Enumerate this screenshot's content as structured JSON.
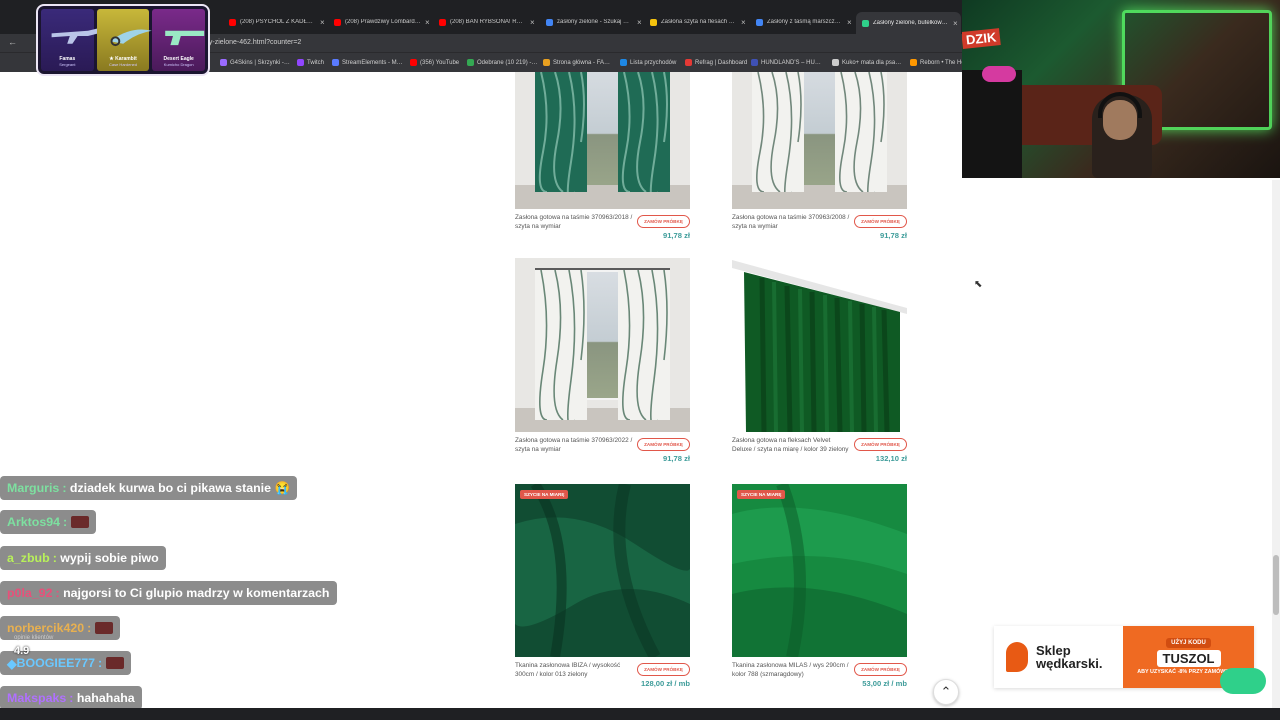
{
  "browser": {
    "tabs": [
      {
        "title": "(208) PSYCHOL Z KADŁUB…",
        "fav": "#ff0000"
      },
      {
        "title": "(208) Prawdziwy Lombard…",
        "fav": "#ff0000"
      },
      {
        "title": "(208) BAN RYBSONA! RO…",
        "fav": "#ff0000"
      },
      {
        "title": "zasłony zielone - Szukaj w…",
        "fav": "#4285f4"
      },
      {
        "title": "Zasłona szyta na flesach z…",
        "fav": "#f4c20d"
      },
      {
        "title": "Zasłony z taśmą marszczą…",
        "fav": "#4285f4"
      },
      {
        "title": "Zasłony zielone, butelkow…",
        "fav": "#2fd08a"
      }
    ],
    "url": "ny-zielone-462.html?counter=2",
    "bookmarks": [
      {
        "label": "G4Skins | Skrzynki -…",
        "color": "#9a6bff"
      },
      {
        "label": "Twitch",
        "color": "#9146ff"
      },
      {
        "label": "StreamElements - M…",
        "color": "#5a7bff"
      },
      {
        "label": "(356) YouTube",
        "color": "#ff0000"
      },
      {
        "label": "Odebrane (10 219) -…",
        "color": "#34a853"
      },
      {
        "label": "Strona główna - FA…",
        "color": "#e8a020"
      },
      {
        "label": "Lista przychodów",
        "color": "#1e88e5"
      },
      {
        "label": "Refrag | Dashboard",
        "color": "#e53935"
      },
      {
        "label": "HUNDLAND'S – HU…",
        "color": "#3f51b5"
      },
      {
        "label": "Kuko+ mata dla psa…",
        "color": "#cccccc"
      },
      {
        "label": "Reborn • The Ho…",
        "color": "#ff9800"
      }
    ]
  },
  "skins": [
    {
      "name": "Famas",
      "sub": "Sergeant"
    },
    {
      "name": "★ Karambit",
      "sub": "Case Hardened"
    },
    {
      "name": "Desert Eagle",
      "sub": "Kumicho Dragon"
    }
  ],
  "webcam": {
    "logo": "DZIK"
  },
  "products": [
    {
      "name": "Zasłona gotowa na taśmie 370963/2018 / szyta na wymiar",
      "button": "ZAMÓW PRÓBKĘ",
      "price": "91,78 zł"
    },
    {
      "name": "Zasłona gotowa na taśmie 370963/2008 / szyta na wymiar",
      "button": "ZAMÓW PRÓBKĘ",
      "price": "91,78 zł"
    },
    {
      "name": "Zasłona gotowa na taśmie 370963/2022 / szyta na wymiar",
      "button": "ZAMÓW PRÓBKĘ",
      "price": "91,78 zł"
    },
    {
      "name": "Zasłona gotowa na fleksach Velvet Deluxe / szyta na miarę / kolor 39 zielony",
      "button": "ZAMÓW PRÓBKĘ",
      "price": "132,10 zł"
    },
    {
      "name": "Tkanina zasłonowa IBIZA / wysokość 300cm / kolor 013 zielony",
      "button": "ZAMÓW PRÓBKĘ",
      "price": "128,00 zł / mb",
      "badge": "SZYCIE NA MIARĘ"
    },
    {
      "name": "Tkanina zasłonowa MILAS / wys 290cm / kolor 788 (szmaragdowy)",
      "button": "ZAMÓW PRÓBKĘ",
      "price": "53,00 zł / mb",
      "badge": "SZYCIE NA MIARĘ"
    }
  ],
  "chat": [
    {
      "user": "Marguris",
      "color": "#7de0a0",
      "msg": "dziadek kurwa bo ci pikawa stanie 😭"
    },
    {
      "user": "Arktos94",
      "color": "#7de0a0",
      "msg": ""
    },
    {
      "user": "a_zbub",
      "color": "#b8f05a",
      "msg": "wypij sobie piwo"
    },
    {
      "user": "p0la_92",
      "color": "#e8507a",
      "msg": "najgorsi to Ci glupio madrzy w komentarzach"
    },
    {
      "user": "norbercik420",
      "color": "#e8b050",
      "msg": ""
    },
    {
      "user": "BOOGIEE777",
      "color": "#6ac8ff",
      "msg": ""
    },
    {
      "user": "Makspaks",
      "color": "#b070ff",
      "msg": "hahahaha"
    }
  ],
  "rating": {
    "value": "4.9",
    "sub": "opinie klientów"
  },
  "smile": "Smile",
  "ad": {
    "brand_line1": "Sklep",
    "brand_line2": "wędkarski.",
    "code_label": "UŻYJ KODU",
    "code": "TUSZOL",
    "discount": "ABY UZYSKAĆ -8% PRZY ZAMÓWIENIU"
  }
}
